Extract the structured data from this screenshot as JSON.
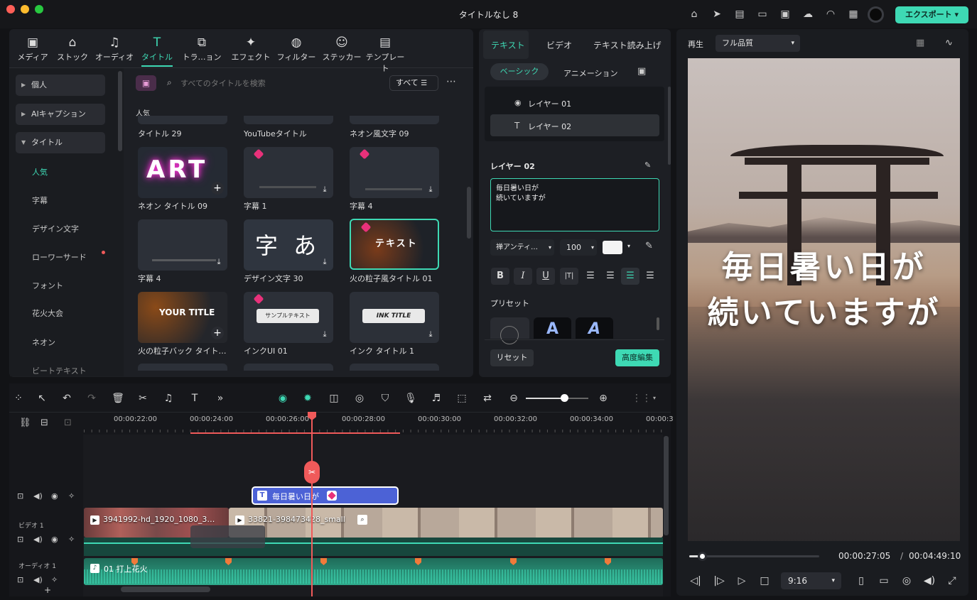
{
  "app": {
    "title": "タイトルなし 8",
    "export_label": "エクスポート"
  },
  "colors": {
    "accent": "#3ed9b4",
    "playhead": "#f05a5a",
    "title_clip": "#4c62d6",
    "audio": "#2fa88a"
  },
  "toolbar": {
    "items": [
      {
        "label": "メディア",
        "icon": "media-icon"
      },
      {
        "label": "ストック",
        "icon": "stock-icon"
      },
      {
        "label": "オーディオ",
        "icon": "music-icon"
      },
      {
        "label": "タイトル",
        "icon": "title-icon",
        "active": true
      },
      {
        "label": "トラ…ョン",
        "icon": "transition-icon"
      },
      {
        "label": "エフェクト",
        "icon": "effect-icon"
      },
      {
        "label": "フィルター",
        "icon": "filter-icon"
      },
      {
        "label": "ステッカー",
        "icon": "sticker-icon"
      },
      {
        "label": "テンプレート",
        "icon": "template-icon"
      }
    ]
  },
  "sidebar": {
    "items": [
      "個人",
      "AIキャプション",
      "タイトル"
    ],
    "subitems": [
      "人気",
      "字幕",
      "デザイン文字",
      "ローワーサード",
      "フォント",
      "花火大会",
      "ネオン",
      "ビートテキスト"
    ]
  },
  "search": {
    "placeholder": "すべてのタイトルを検索",
    "filter_label": "すべて"
  },
  "library": {
    "section": "人気",
    "top_labels": [
      "タイトル 29",
      "YouTubeタイトル",
      "ネオン風文字 09"
    ],
    "cards": [
      {
        "label": "ネオン タイトル 09",
        "thumb_text": "ART"
      },
      {
        "label": "字幕 1",
        "thumb_text": ""
      },
      {
        "label": "字幕 4",
        "thumb_text": ""
      },
      {
        "label": "字幕 4",
        "thumb_text": ""
      },
      {
        "label": "デザイン文字 30",
        "thumb_text": "字 あ"
      },
      {
        "label": "火の粒子風タイトル 01",
        "thumb_text": "テキスト"
      },
      {
        "label": "火の粒子バック タイト…",
        "thumb_text": "YOUR TITLE"
      },
      {
        "label": "インクUI 01",
        "thumb_text": "サンプルテキスト"
      },
      {
        "label": "インク タイトル 1",
        "thumb_text": "INK TITLE"
      }
    ]
  },
  "inspector": {
    "tabs": [
      "テキスト",
      "ビデオ",
      "テキスト読み上げ"
    ],
    "subtabs": [
      "ベーシック",
      "アニメーション"
    ],
    "layers": [
      "レイヤー 01",
      "レイヤー 02"
    ],
    "selected_layer": "レイヤー 02",
    "text_value": "毎日暑い日が\n続いていますが",
    "font": "禅アンティ…",
    "size": "100",
    "presets_label": "プリセット",
    "reset_label": "リセット",
    "advanced_label": "高度編集"
  },
  "preview": {
    "play_label": "再生",
    "quality": "フル品質",
    "overlay_line1": "毎日暑い日が",
    "overlay_line2": "続いていますが",
    "current_time": "00:00:27:05",
    "separator": "/",
    "total_time": "00:04:49:10",
    "aspect": "9:16",
    "progress": 0.1
  },
  "timeline": {
    "ruler": [
      "00:00:22:00",
      "00:00:24:00",
      "00:00:26:00",
      "00:00:28:00",
      "00:00:30:00",
      "00:00:32:00",
      "00:00:34:00",
      "00:00:3"
    ],
    "title_clip": "毎日暑い日が",
    "video_track_label": "ビデオ 1",
    "audio_track_label": "オーディオ 1",
    "video_clip1": "3941992-hd_1920_1080_3…",
    "video_clip2": "33821-398473428_small",
    "audio_clip": "01 打上花火"
  }
}
